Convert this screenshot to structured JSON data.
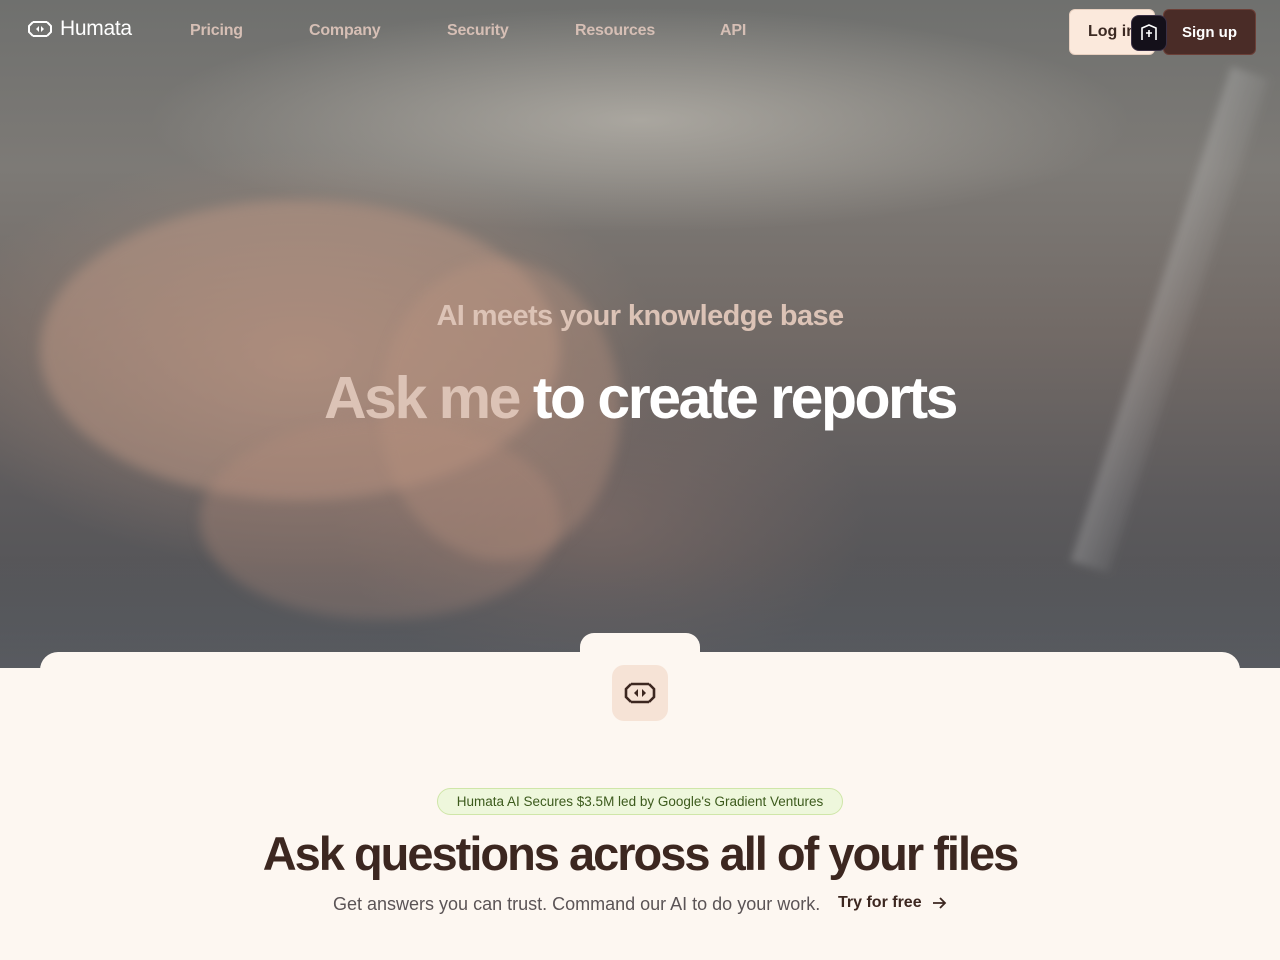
{
  "brand": {
    "name": "Humata"
  },
  "nav": {
    "items": [
      {
        "label": "Pricing"
      },
      {
        "label": "Company"
      },
      {
        "label": "Security"
      },
      {
        "label": "Resources"
      },
      {
        "label": "API"
      }
    ],
    "login_label": "Log in",
    "signup_label": "Sign up"
  },
  "hero": {
    "subtitle": "AI meets your knowledge base",
    "title_accent": "Ask me",
    "title_rest": "to create reports"
  },
  "section": {
    "news_pill": "Humata AI Secures $3.5M led by Google's Gradient Ventures",
    "title": "Ask questions across all of your files",
    "subtitle": "Get answers you can trust. Command our AI to do your work.",
    "cta_label": "Try for free"
  },
  "icons": {
    "logo": "humata-logo-icon",
    "app": "humata-app-icon",
    "cta_arrow": "arrow-right-icon",
    "extension": "browser-extension-icon"
  },
  "colors": {
    "accent": "#dcc3b6",
    "signup_bg": "#4a2c27",
    "login_bg": "#fbe9dc",
    "page_bg": "#fdf7f1",
    "pill_bg": "#eef7dc",
    "pill_text": "#3c5a1c",
    "heading": "#3c2720"
  }
}
